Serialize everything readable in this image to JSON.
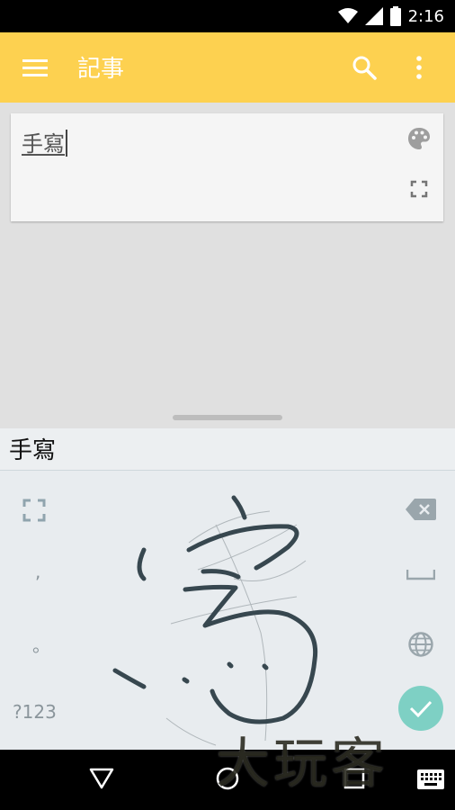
{
  "status_bar": {
    "time": "2:16"
  },
  "app_bar": {
    "title": "記事",
    "color": "#fdd150"
  },
  "note": {
    "text": "手寫"
  },
  "keyboard": {
    "candidate": "手寫",
    "keys_left": [
      ",",
      "。",
      "?123"
    ],
    "fab_color": "#7ed0c4"
  },
  "watermark": "大玩客",
  "icons": {
    "menu": "menu-icon",
    "search": "search-icon",
    "more": "more-vert-icon",
    "palette": "palette-icon",
    "fullscreen": "fullscreen-icon",
    "backspace": "backspace-icon",
    "space": "space-bar-icon",
    "globe": "globe-icon",
    "check": "check-icon",
    "back": "back-icon",
    "home": "home-icon",
    "recents": "recents-icon",
    "keyboard_switch": "keyboard-switch-icon"
  }
}
